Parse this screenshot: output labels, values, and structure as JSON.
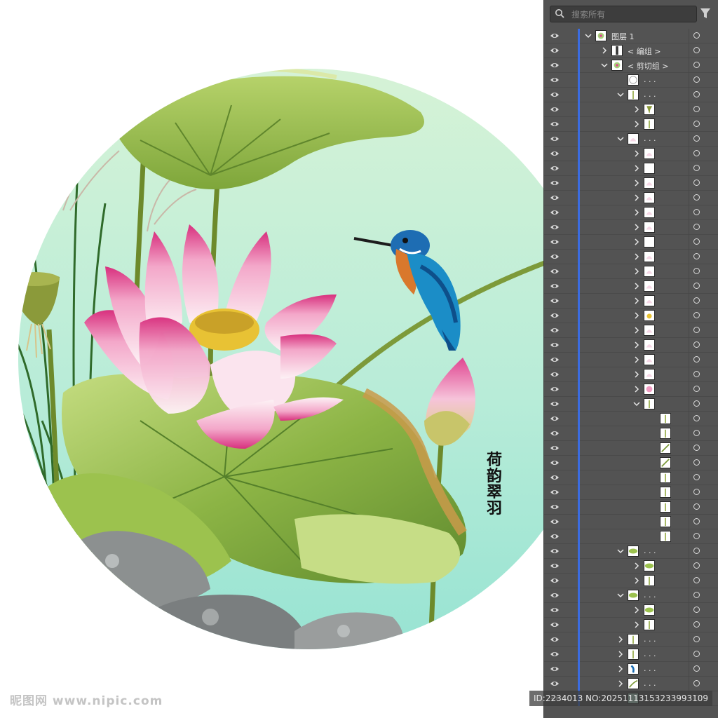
{
  "panel": {
    "search_placeholder": "搜索所有",
    "layers": [
      {
        "depth": 0,
        "expand": "open",
        "label": "图层 1",
        "thumb": "layer-thumb"
      },
      {
        "depth": 1,
        "expand": "closed",
        "label": "< 编组 >",
        "thumb": "group-thumb"
      },
      {
        "depth": 1,
        "expand": "open",
        "label": "< 剪切组 >",
        "thumb": "clip-thumb"
      },
      {
        "depth": 2,
        "expand": "none",
        "label": ". . .",
        "thumb": "circle-path"
      },
      {
        "depth": 2,
        "expand": "open",
        "label": ". . .",
        "thumb": "stem"
      },
      {
        "depth": 3,
        "expand": "closed",
        "label": "",
        "thumb": "seedpod"
      },
      {
        "depth": 3,
        "expand": "closed",
        "label": "",
        "thumb": "stem"
      },
      {
        "depth": 2,
        "expand": "open",
        "label": ". . .",
        "thumb": "petal"
      },
      {
        "depth": 3,
        "expand": "closed",
        "label": "",
        "thumb": "petal"
      },
      {
        "depth": 3,
        "expand": "closed",
        "label": "",
        "thumb": "blank"
      },
      {
        "depth": 3,
        "expand": "closed",
        "label": "",
        "thumb": "petal"
      },
      {
        "depth": 3,
        "expand": "closed",
        "label": "",
        "thumb": "petal"
      },
      {
        "depth": 3,
        "expand": "closed",
        "label": "",
        "thumb": "petal"
      },
      {
        "depth": 3,
        "expand": "closed",
        "label": "",
        "thumb": "petal"
      },
      {
        "depth": 3,
        "expand": "closed",
        "label": "",
        "thumb": "blank"
      },
      {
        "depth": 3,
        "expand": "closed",
        "label": "",
        "thumb": "petal"
      },
      {
        "depth": 3,
        "expand": "closed",
        "label": "",
        "thumb": "petal"
      },
      {
        "depth": 3,
        "expand": "closed",
        "label": "",
        "thumb": "petal"
      },
      {
        "depth": 3,
        "expand": "closed",
        "label": "",
        "thumb": "petal"
      },
      {
        "depth": 3,
        "expand": "closed",
        "label": "",
        "thumb": "pod-yellow"
      },
      {
        "depth": 3,
        "expand": "closed",
        "label": "",
        "thumb": "petal"
      },
      {
        "depth": 3,
        "expand": "closed",
        "label": "",
        "thumb": "petal"
      },
      {
        "depth": 3,
        "expand": "closed",
        "label": "",
        "thumb": "petal"
      },
      {
        "depth": 3,
        "expand": "closed",
        "label": "",
        "thumb": "petal"
      },
      {
        "depth": 3,
        "expand": "closed",
        "label": "",
        "thumb": "lotus"
      },
      {
        "depth": 3,
        "expand": "open",
        "label": "",
        "thumb": "stem"
      },
      {
        "depth": 4,
        "expand": "none",
        "label": "",
        "thumb": "stem"
      },
      {
        "depth": 4,
        "expand": "none",
        "label": "",
        "thumb": "stem"
      },
      {
        "depth": 4,
        "expand": "none",
        "label": "",
        "thumb": "grass"
      },
      {
        "depth": 4,
        "expand": "none",
        "label": "",
        "thumb": "grass"
      },
      {
        "depth": 4,
        "expand": "none",
        "label": "",
        "thumb": "stem"
      },
      {
        "depth": 4,
        "expand": "none",
        "label": "",
        "thumb": "stem"
      },
      {
        "depth": 4,
        "expand": "none",
        "label": "",
        "thumb": "stem"
      },
      {
        "depth": 4,
        "expand": "none",
        "label": "",
        "thumb": "stem"
      },
      {
        "depth": 4,
        "expand": "none",
        "label": "",
        "thumb": "stem"
      },
      {
        "depth": 2,
        "expand": "open",
        "label": ". . .",
        "thumb": "leaf"
      },
      {
        "depth": 3,
        "expand": "closed",
        "label": "",
        "thumb": "leaf"
      },
      {
        "depth": 3,
        "expand": "closed",
        "label": "",
        "thumb": "stem"
      },
      {
        "depth": 2,
        "expand": "open",
        "label": ". . .",
        "thumb": "leaf"
      },
      {
        "depth": 3,
        "expand": "closed",
        "label": "",
        "thumb": "leaf"
      },
      {
        "depth": 3,
        "expand": "closed",
        "label": "",
        "thumb": "stem"
      },
      {
        "depth": 2,
        "expand": "closed",
        "label": ". . .",
        "thumb": "stem"
      },
      {
        "depth": 2,
        "expand": "closed",
        "label": ". . .",
        "thumb": "stem"
      },
      {
        "depth": 2,
        "expand": "closed",
        "label": ". . .",
        "thumb": "bird"
      },
      {
        "depth": 2,
        "expand": "closed",
        "label": ". . .",
        "thumb": "branch"
      },
      {
        "depth": 2,
        "expand": "none",
        "label": ". . .",
        "thumb": "bg"
      }
    ]
  },
  "artwork": {
    "calligraphy": [
      "荷",
      "韵",
      "翠",
      "羽"
    ]
  },
  "watermark": {
    "left": "昵图网 www.nipic.com",
    "right": "ID:2234013 NO:20251113153233993109"
  },
  "colors": {
    "panel_bg": "#535353",
    "accent_stripe": "#3b6ce0",
    "bg_top": "#d4f1d2",
    "bg_bottom": "#8fe0d0",
    "lotus_pink": "#e04590",
    "leaf_green": "#8fb845"
  }
}
